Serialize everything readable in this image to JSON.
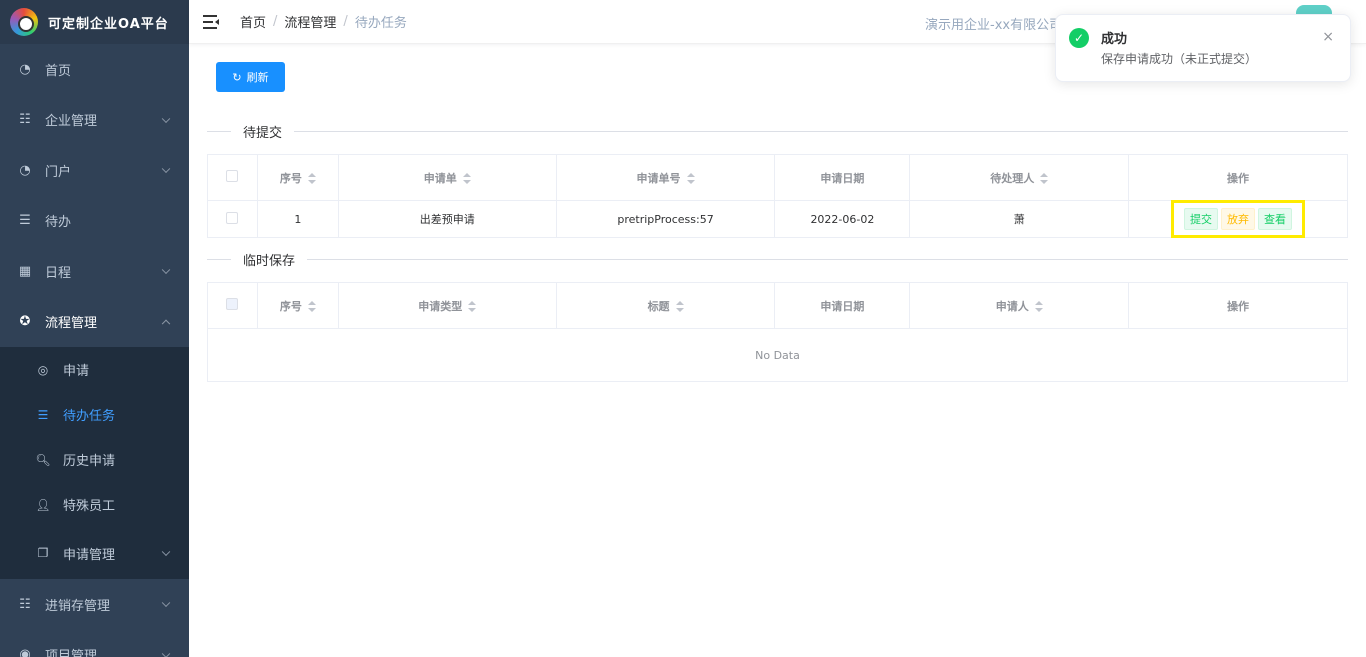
{
  "app": {
    "title": "可定制企业OA平台"
  },
  "sidebar": {
    "items": [
      {
        "label": "首页",
        "icon": "dashboard-icon"
      },
      {
        "label": "企业管理",
        "icon": "tree-list-icon"
      },
      {
        "label": "门户",
        "icon": "dashboard-icon"
      },
      {
        "label": "待办",
        "icon": "list-icon"
      },
      {
        "label": "日程",
        "icon": "grid-icon"
      },
      {
        "label": "流程管理",
        "icon": "process-icon"
      }
    ],
    "subitems": [
      {
        "label": "申请",
        "icon": "target-icon"
      },
      {
        "label": "待办任务",
        "icon": "list-icon"
      },
      {
        "label": "历史申请",
        "icon": "search-icon"
      },
      {
        "label": "特殊员工",
        "icon": "user-icon"
      },
      {
        "label": "申请管理",
        "icon": "copy-icon"
      }
    ],
    "items_after": [
      {
        "label": "进销存管理",
        "icon": "tree-list-icon"
      },
      {
        "label": "项目管理",
        "icon": "eye-icon"
      }
    ]
  },
  "header": {
    "breadcrumb": [
      "首页",
      "流程管理",
      "待办任务"
    ],
    "breadcrumb_sep": "/",
    "company": "演示用企业-xx有限公司"
  },
  "toolbar": {
    "refresh_label": "刷新"
  },
  "section_pending": {
    "title": "待提交",
    "columns": [
      "序号",
      "申请单",
      "申请单号",
      "申请日期",
      "待处理人",
      "操作"
    ],
    "rows": [
      {
        "index": "1",
        "form": "出差预申请",
        "number": "pretripProcess:57",
        "date": "2022-06-02",
        "handler": "萧"
      }
    ],
    "actions": {
      "submit": "提交",
      "abandon": "放弃",
      "view": "查看"
    }
  },
  "section_draft": {
    "title": "临时保存",
    "columns": [
      "序号",
      "申请类型",
      "标题",
      "申请日期",
      "申请人",
      "操作"
    ],
    "empty_text": "No Data"
  },
  "notification": {
    "title": "成功",
    "message": "保存申请成功（未正式提交）",
    "close": "×"
  },
  "colors": {
    "sidebar_bg": "#304156",
    "submenu_bg": "#1f2d3d",
    "active": "#409eff",
    "primary_button": "#1890ff",
    "success": "#13ce66",
    "warning": "#ffba00",
    "highlight_box": "#ffeb00"
  }
}
